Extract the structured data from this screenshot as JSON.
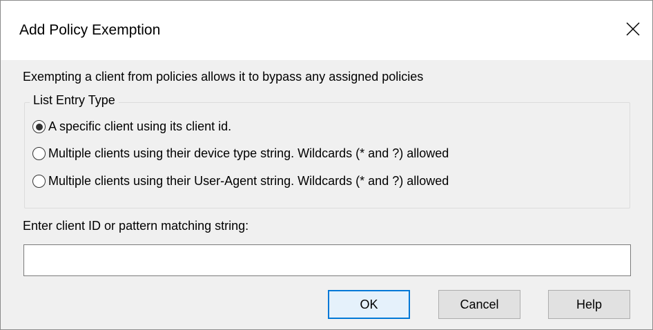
{
  "dialog": {
    "title": "Add Policy Exemption",
    "intro": "Exempting a client from policies allows it to bypass any assigned policies"
  },
  "group": {
    "legend": "List Entry Type",
    "options": [
      {
        "label": "A specific client using its client id.",
        "selected": true
      },
      {
        "label": "Multiple clients using their device type string. Wildcards (* and ?) allowed",
        "selected": false
      },
      {
        "label": "Multiple clients using their User-Agent string. Wildcards (* and ?) allowed",
        "selected": false
      }
    ]
  },
  "input": {
    "label": "Enter client ID or pattern matching string:",
    "value": "",
    "placeholder": ""
  },
  "buttons": {
    "ok": "OK",
    "cancel": "Cancel",
    "help": "Help"
  },
  "icons": {
    "close": "close-icon"
  },
  "colors": {
    "accent": "#0078d7",
    "dialog_bg": "#f0f0f0",
    "titlebar_bg": "#ffffff"
  }
}
